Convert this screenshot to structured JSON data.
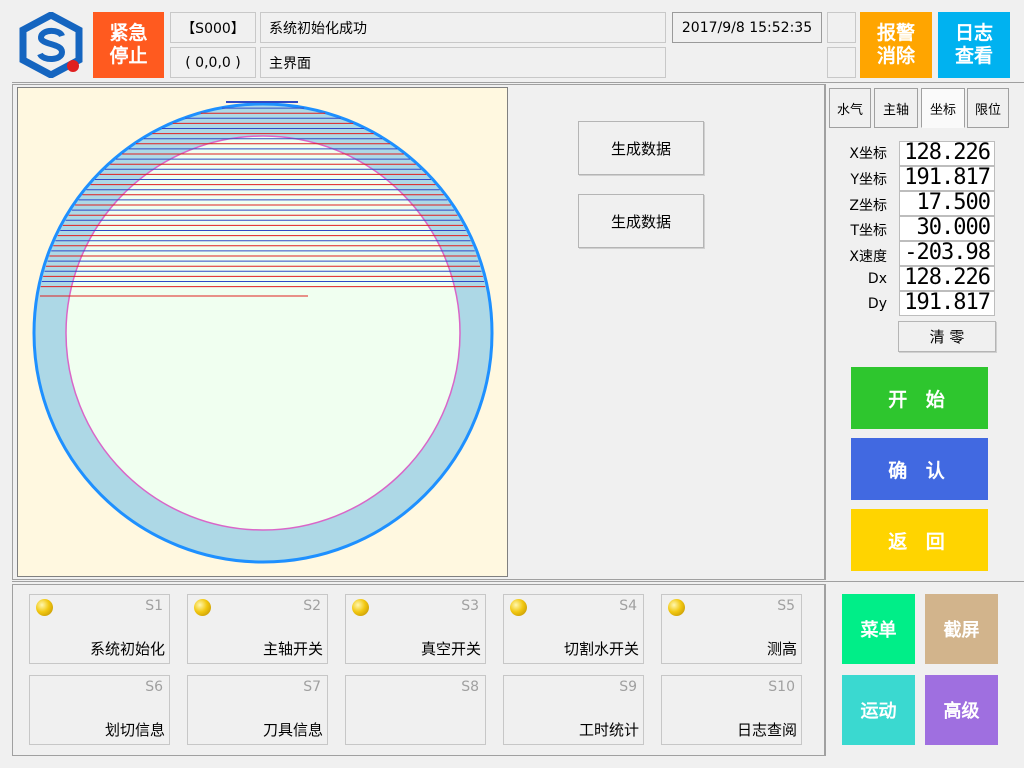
{
  "colors": {
    "emergency": "#ff5a1f",
    "alarm": "#ffa500",
    "log": "#00b2f0",
    "start": "#2ec62e",
    "confirm": "#4169e1",
    "back": "#ffd400",
    "menu": "#00ee88",
    "screenshot": "#d2b48c",
    "motion": "#3ad9d0",
    "advanced": "#9f6fe0",
    "plate_bg": "#fff8e0",
    "ring": "#add8e6",
    "ring_edge": "#1e90ff",
    "inner_fill": "#f0fff0",
    "inner_edge": "#d966c8",
    "cut_blue": "#2f49c6",
    "cut_red": "#e02020"
  },
  "header": {
    "logo": "company-logo-icon",
    "emergency_label": "紧急\n停止",
    "status_code": "【S000】",
    "status_message": "系统初始化成功",
    "datetime": "2017/9/8 15:52:35",
    "position": "( 0,0,0 )",
    "screen_name": "主界面",
    "alarm_clear_label": "报警\n消除",
    "log_view_label": "日志\n查看"
  },
  "center": {
    "generate_btn_1": "生成数据",
    "generate_btn_2": "生成数据"
  },
  "tabs": [
    {
      "label": "水气",
      "active": false
    },
    {
      "label": "主轴",
      "active": false
    },
    {
      "label": "坐标",
      "active": true
    },
    {
      "label": "限位",
      "active": false
    }
  ],
  "coords": [
    {
      "label": "X坐标",
      "value": "128.226"
    },
    {
      "label": "Y坐标",
      "value": "191.817"
    },
    {
      "label": "Z坐标",
      "value": "17.500"
    },
    {
      "label": "T坐标",
      "value": "30.000"
    },
    {
      "label": "X速度",
      "value": "-203.98"
    },
    {
      "label": "Dx",
      "value": "128.226"
    },
    {
      "label": "Dy",
      "value": "191.817"
    }
  ],
  "clear_label": "清 零",
  "actions": {
    "start": "开 始",
    "confirm": "确 认",
    "back": "返 回"
  },
  "status_buttons": [
    {
      "code": "S1",
      "name": "系统初始化",
      "indicator": true
    },
    {
      "code": "S2",
      "name": "主轴开关",
      "indicator": true
    },
    {
      "code": "S3",
      "name": "真空开关",
      "indicator": true
    },
    {
      "code": "S4",
      "name": "切割水开关",
      "indicator": true
    },
    {
      "code": "S5",
      "name": "测高",
      "indicator": true
    },
    {
      "code": "S6",
      "name": "划切信息",
      "indicator": false
    },
    {
      "code": "S7",
      "name": "刀具信息",
      "indicator": false
    },
    {
      "code": "S8",
      "name": "",
      "indicator": false
    },
    {
      "code": "S9",
      "name": "工时统计",
      "indicator": false
    },
    {
      "code": "S10",
      "name": "日志查阅",
      "indicator": false
    }
  ],
  "menu": {
    "menu": "菜单",
    "screenshot": "截屏",
    "motion": "运动",
    "advanced": "高级"
  }
}
